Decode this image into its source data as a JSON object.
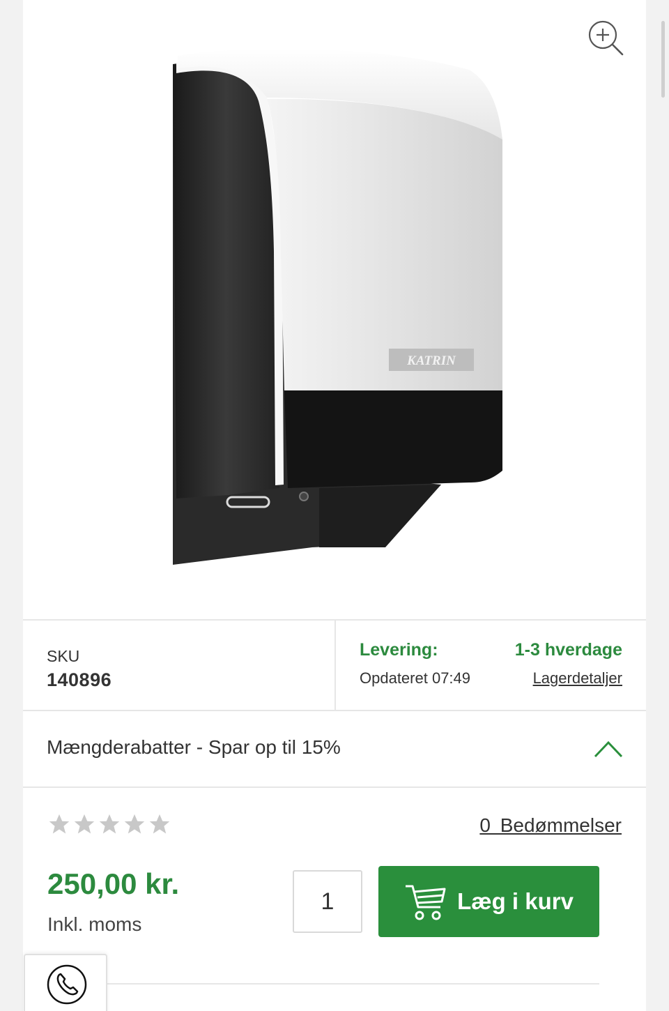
{
  "product": {
    "image_alt": "",
    "brand_label": "KATRIN",
    "zoom_icon": "zoom-in-icon"
  },
  "info": {
    "sku_label": "SKU",
    "sku_value": "140896",
    "delivery_label": "Levering:",
    "delivery_value": "1-3 hverdage",
    "updated_text": "Opdateret 07:49",
    "stock_link": "Lagerdetaljer"
  },
  "discount": {
    "text": "Mængderabatter - Spar op til 15%",
    "expanded": true
  },
  "rating": {
    "stars": 0,
    "max_stars": 5,
    "reviews_link": "0  Bedømmelser"
  },
  "pricing": {
    "price": "250,00 kr.",
    "vat_note": "Inkl. moms"
  },
  "purchase": {
    "quantity": "1",
    "add_to_cart_label": "Læg i kurv"
  },
  "colors": {
    "accent_green": "#2a8f3c",
    "star_gray": "#c8c8c8"
  },
  "icons": {
    "cart": "shopping-cart-icon",
    "phone": "phone-icon",
    "chevron": "chevron-up-icon"
  }
}
